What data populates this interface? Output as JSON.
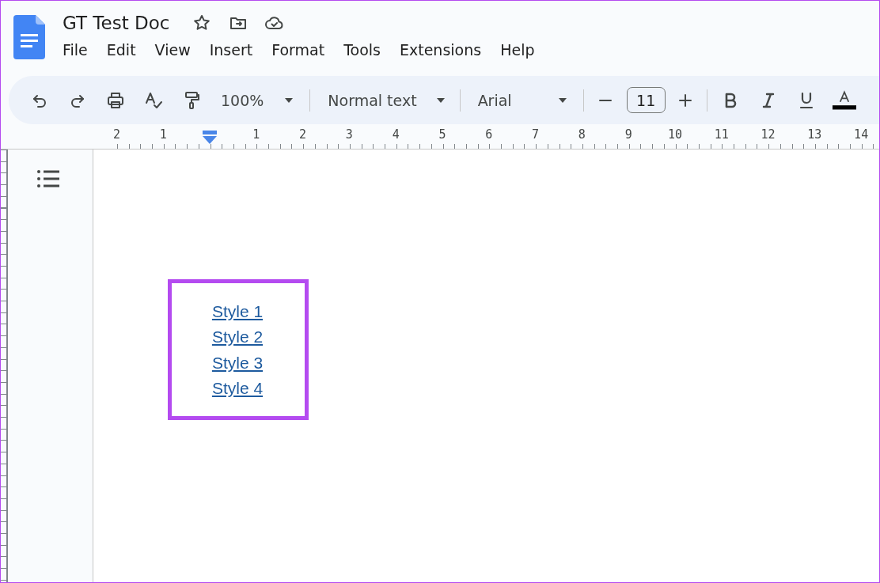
{
  "document_title": "GT Test Doc",
  "menu": [
    "File",
    "Edit",
    "View",
    "Insert",
    "Format",
    "Tools",
    "Extensions",
    "Help"
  ],
  "toolbar": {
    "zoom": "100%",
    "style": "Normal text",
    "font": "Arial",
    "font_size": "11"
  },
  "ruler": {
    "left_labels": [
      "2",
      "1"
    ],
    "labels": [
      "1",
      "2",
      "3",
      "4",
      "5",
      "6",
      "7",
      "8",
      "9",
      "10",
      "11",
      "12",
      "13",
      "14"
    ]
  },
  "links": [
    "Style 1",
    "Style 2",
    "Style 3",
    "Style 4"
  ]
}
